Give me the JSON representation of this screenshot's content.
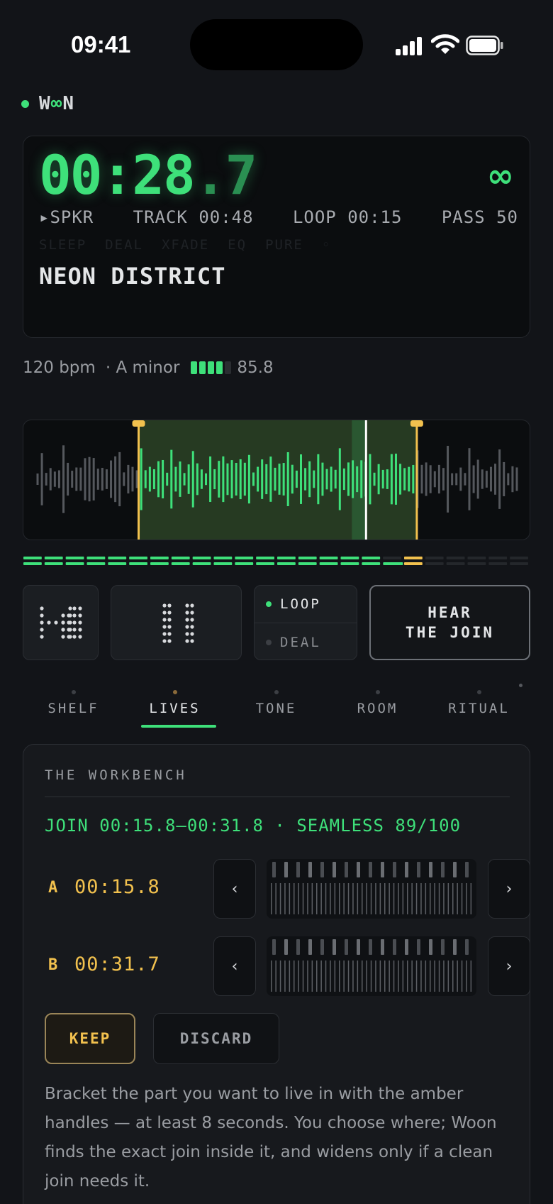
{
  "status_bar": {
    "time": "09:41"
  },
  "brand": {
    "prefix": "W",
    "mid": "∞",
    "suffix": "N"
  },
  "display": {
    "time_main": "00:28",
    "time_sep": ".",
    "time_tenth": "7",
    "infinity": "∞",
    "info": [
      "▸SPKR",
      "TRACK 00:48",
      "LOOP 00:15",
      "PASS 50"
    ],
    "dim": [
      "SLEEP",
      "DEAL",
      "XFADE",
      "EQ",
      "PURE",
      "◦"
    ],
    "title": "NEON DISTRICT"
  },
  "meta": {
    "bpm": "120 bpm",
    "key": "· A minor",
    "score": "85.8",
    "meter_level": 0.8
  },
  "waveform": {
    "loop_start_fraction": 0.227,
    "loop_end_fraction": 0.775,
    "playhead_fraction": 0.675,
    "progress_fraction": 0.71,
    "colors": {
      "played": "#3ee07a",
      "marker": "#f2c14e",
      "idle": "#55585d"
    }
  },
  "controls": {
    "mode_loop": "LOOP",
    "mode_deal": "DEAL",
    "hear_line1": "HEAR",
    "hear_line2": "THE JOIN"
  },
  "tabs": [
    {
      "label": "SHELF"
    },
    {
      "label": "LIVES",
      "active": true
    },
    {
      "label": "TONE"
    },
    {
      "label": "ROOM"
    },
    {
      "label": "RITUAL"
    }
  ],
  "workbench": {
    "title": "THE WORKBENCH",
    "join": "JOIN 00:15.8—00:31.8 · SEAMLESS 89/100",
    "a_label": "A",
    "a_value": "00:15.8",
    "b_label": "B",
    "b_value": "00:31.7",
    "nudge_left": "‹",
    "nudge_right": "›",
    "keep": "KEEP",
    "discard": "DISCARD",
    "help": "Bracket the part you want to live in with the amber handles — at least 8 seconds. You choose where; Woon finds the exact join inside it, and widens only if a clean join needs it."
  }
}
